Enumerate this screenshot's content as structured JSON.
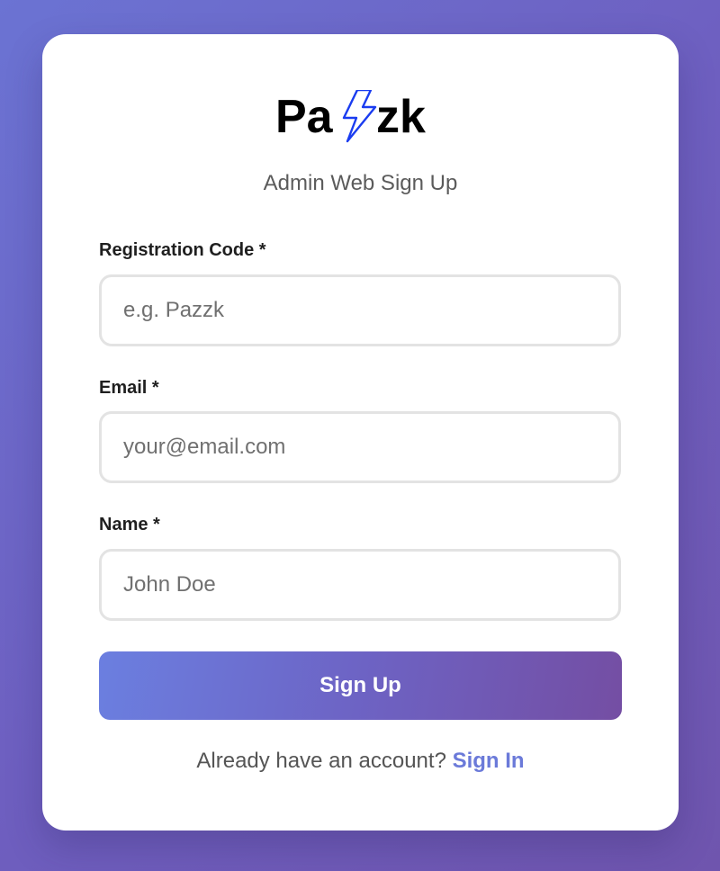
{
  "brand": {
    "name": "Pazzk",
    "bolt_color": "#1a3cf0"
  },
  "subtitle": "Admin Web Sign Up",
  "form": {
    "registration_code": {
      "label": "Registration Code *",
      "value": "",
      "placeholder": "e.g. Pazzk"
    },
    "email": {
      "label": "Email *",
      "value": "",
      "placeholder": "your@email.com"
    },
    "name": {
      "label": "Name *",
      "value": "",
      "placeholder": "John Doe"
    },
    "submit_label": "Sign Up"
  },
  "footer": {
    "prompt": "Already have an account?",
    "link_label": "Sign In"
  },
  "colors": {
    "background_start": "#6b73d3",
    "background_end": "#6f55ae",
    "accent_link": "#6b7ad9",
    "button_gradient_start": "#6b7fe0",
    "button_gradient_end": "#744ea3"
  }
}
